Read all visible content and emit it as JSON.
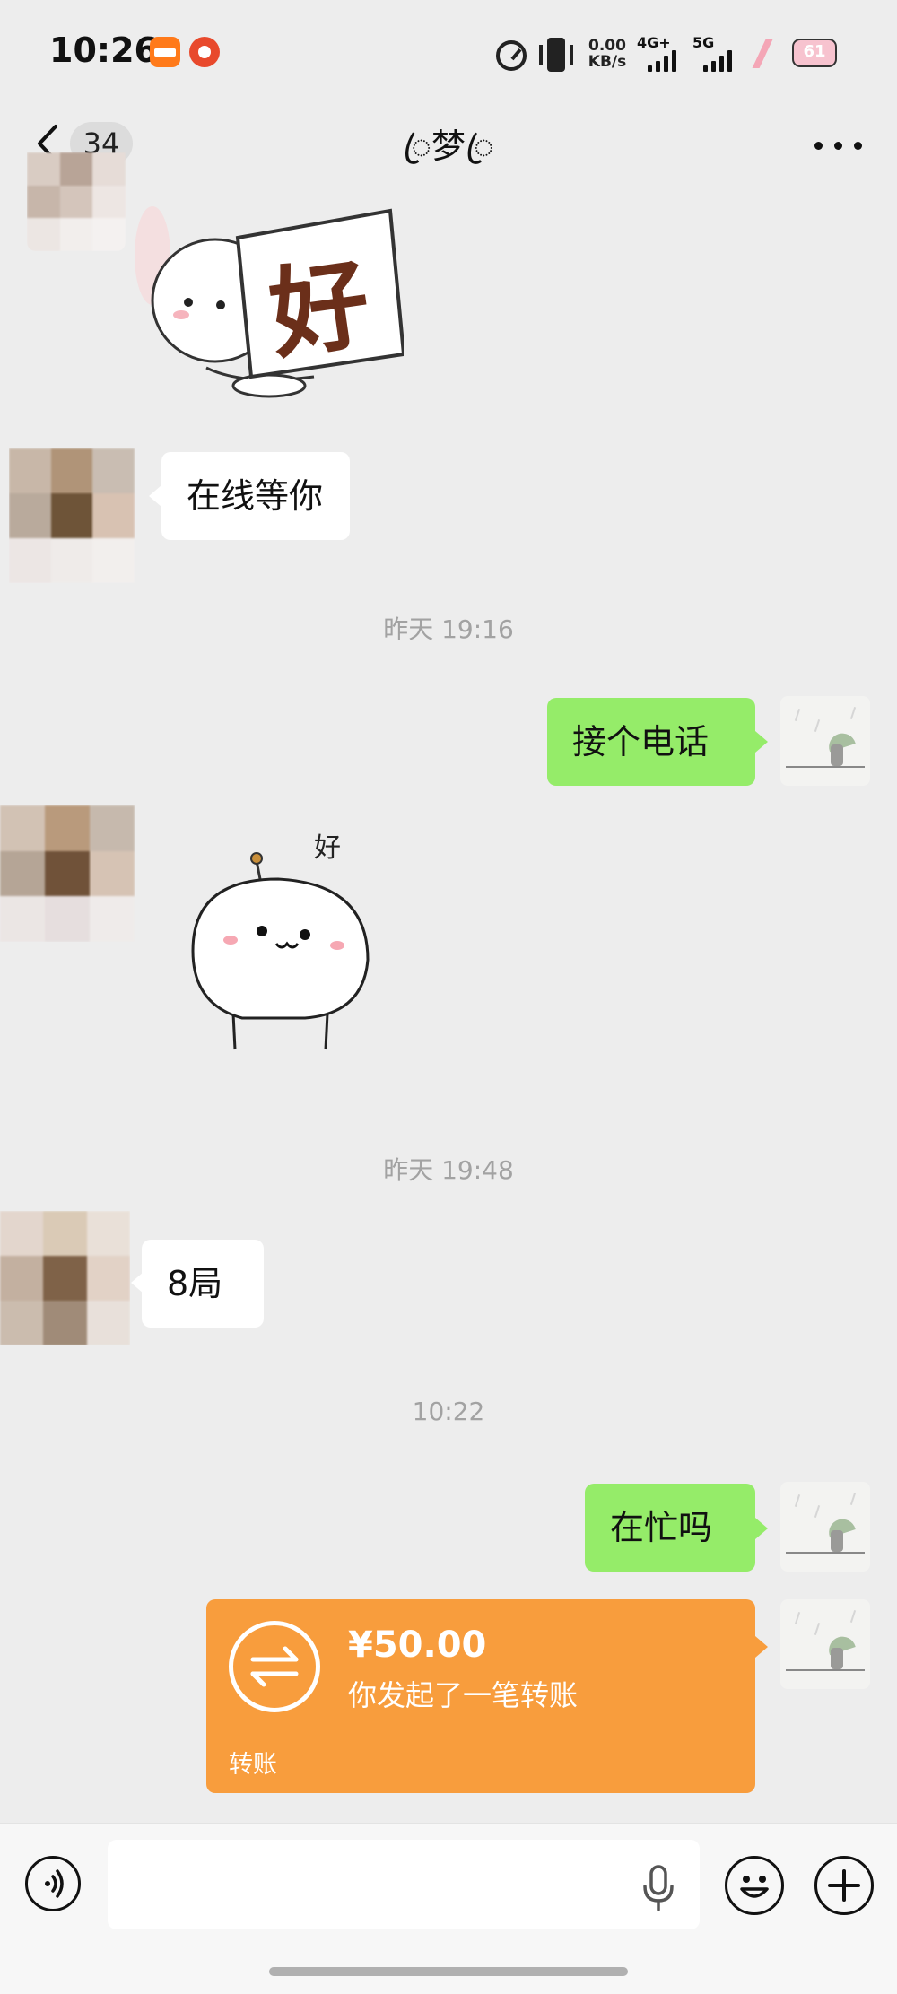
{
  "status_bar": {
    "time": "10:26",
    "net_speed_value": "0.00",
    "net_speed_unit": "KB/s",
    "sim1_label": "4G+",
    "sim2_label": "5G",
    "battery": "61"
  },
  "nav": {
    "unread_count": "34",
    "title": "ꦿ梦ꦿ"
  },
  "messages": {
    "m2_text": "在线等你",
    "ts1": "昨天 19:16",
    "m3_text": "接个电话",
    "ts2": "昨天 19:48",
    "m5_text": "8局",
    "ts3": "10:22",
    "m6_text": "在忙吗"
  },
  "stickers": {
    "hao_char": "好",
    "hao_small": "好"
  },
  "transfer": {
    "amount": "¥50.00",
    "description": "你发起了一笔转账",
    "label": "转账"
  },
  "input_bar": {
    "placeholder": ""
  },
  "colors": {
    "background": "#ededed",
    "outgoing_bubble": "#95ec69",
    "incoming_bubble": "#ffffff",
    "transfer_card": "#f89d3d"
  }
}
